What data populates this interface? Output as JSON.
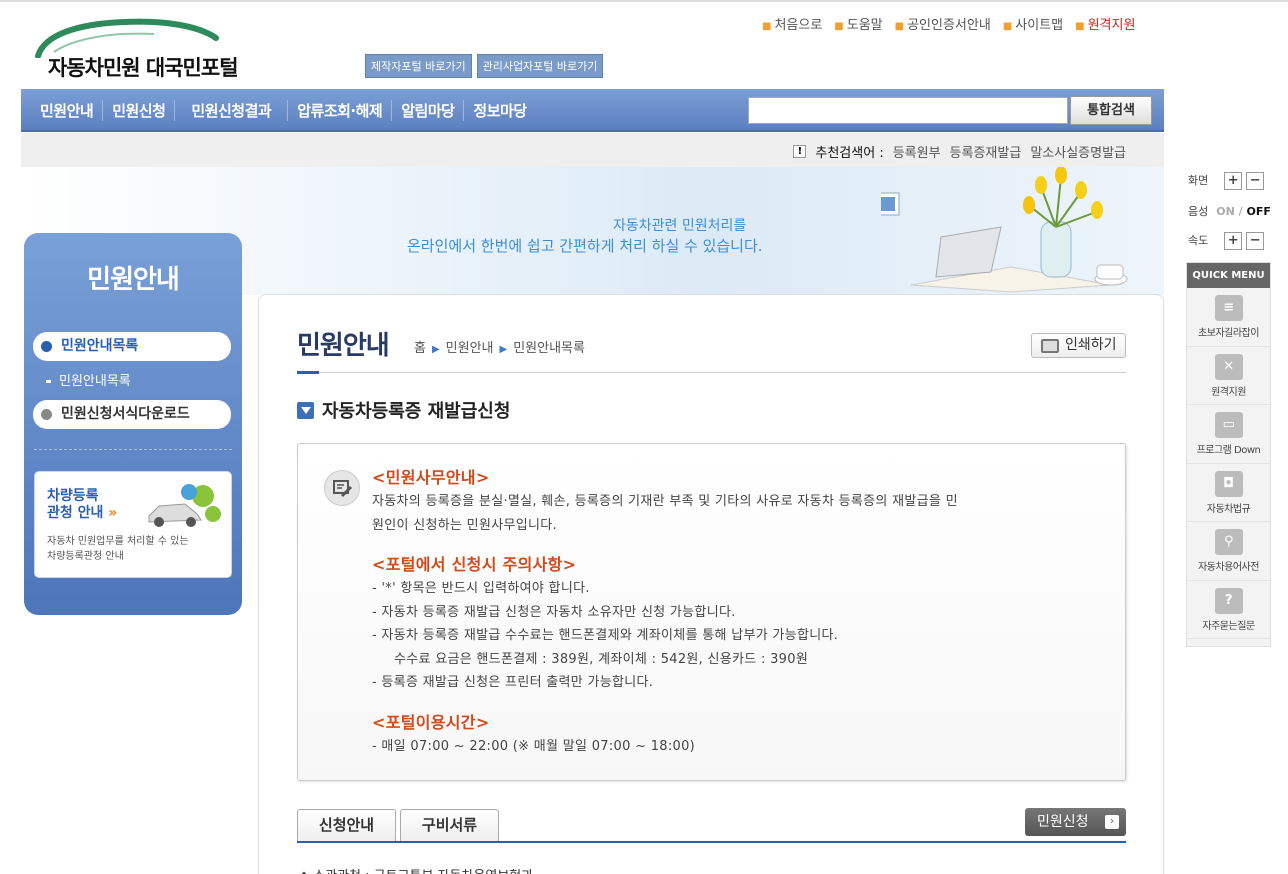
{
  "header": {
    "logo_text": "자동차민원 대국민포털",
    "portal_buttons": [
      "제작자포털 바로가기",
      "관리사업자포털 바로가기"
    ],
    "util_links": [
      "처음으로",
      "도움말",
      "공인인증서안내",
      "사이트맵",
      "원격지원"
    ]
  },
  "gnb": {
    "items": [
      "민원안내",
      "민원신청",
      "민원신청결과",
      "압류조회·해제",
      "알림마당",
      "정보마당"
    ],
    "search_placeholder": "",
    "search_button": "통합검색"
  },
  "recommend": {
    "label": "추천검색어 :",
    "keywords": [
      "등록원부",
      "등록증재발급",
      "말소사실증명발급"
    ]
  },
  "banner": {
    "line1": "자동차관련 민원처리를",
    "line2": "온라인에서 한번에 쉽고 간편하게 처리 하실 수 있습니다."
  },
  "lnb": {
    "title": "민원안내",
    "menu1": "민원안내목록",
    "sub1": "민원안내목록",
    "menu2": "민원신청서식다운로드",
    "box_title_1": "차량등록",
    "box_title_2": "관청 안내",
    "box_arrow": "»",
    "box_desc_1": "자동차 민원업무를 처리할 수 있는",
    "box_desc_2": "차량등록관청 안내"
  },
  "content": {
    "title": "민원안내",
    "breadcrumb": [
      "홈",
      "민원안내",
      "민원안내목록"
    ],
    "print_button": "인쇄하기",
    "section_title": "자동차등록증 재발급신청",
    "h1": "<민원사무안내>",
    "p1_1": "자동차의 등록증을 분실·멸실, 훼손, 등록증의 기재란 부족 및 기타의 사유로 자동차 등록증의 재발급을 민",
    "p1_2": "원인이 신청하는 민원사무입니다.",
    "h2": "<포털에서 신청시 주의사항>",
    "n1": "- '*' 항목은 반드시 입력하여야 합니다.",
    "n2": "- 자동차 등록증 재발급 신청은 자동차 소유자만 신청 가능합니다.",
    "n3": "- 자동차 등록증 재발급 수수료는 핸드폰결제와 계좌이체를 통해 납부가 가능합니다.",
    "n4": "수수료 요금은 핸드폰결제 : 389원, 계좌이체 : 542원, 신용카드 : 390원",
    "n5": "- 등록증 재발급 신청은 프린터 출력만 가능합니다.",
    "h3": "<포털이용시간>",
    "t1": "- 매일 07:00 ~ 22:00 (※ 매월 말일 07:00 ~ 18:00)",
    "tabs": [
      "신청안내",
      "구비서류"
    ],
    "apply_button": "민원신청",
    "peek_text": "◆ 소관관청      : 국토교통부 자동차운영보험과"
  },
  "quick": {
    "screen_label": "화면",
    "voice_label": "음성",
    "voice_on": "ON",
    "voice_sep": "/",
    "voice_off": "OFF",
    "speed_label": "속도",
    "plus": "+",
    "minus": "−",
    "menu_title": "QUICK MENU",
    "items": [
      "초보자길라잡이",
      "원격지원",
      "프로그램 Down",
      "자동차법규",
      "자동차용어사전",
      "자주묻는질문"
    ]
  }
}
